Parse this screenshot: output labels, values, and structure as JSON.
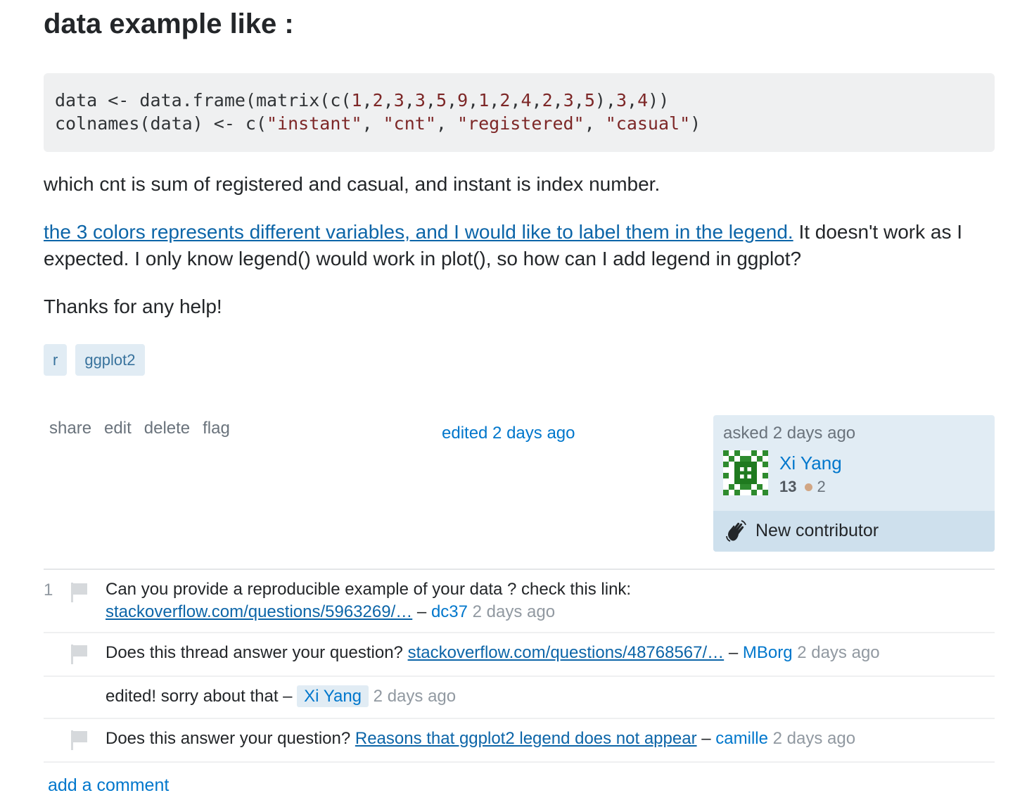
{
  "question": {
    "heading": "data example like :",
    "code_line1": "data <- data.frame(matrix(c(1,2,3,3,5,9,1,2,4,2,3,5),3,4))",
    "code_line2": "colnames(data) <- c(\"instant\", \"cnt\", \"registered\", \"casual\")",
    "para1": "which cnt is sum of registered and casual, and instant is index number.",
    "para2_link": "the 3 colors represents different variables, and I would like to label them in the legend.",
    "para2_text": " It doesn't work as I expected. I only know legend() would work in plot(), so how can I add legend in ggplot?",
    "para3": "Thanks for any help!",
    "tags": [
      "r",
      "ggplot2"
    ]
  },
  "post_menu": {
    "share": "share",
    "edit": "edit",
    "delete": "delete",
    "flag": "flag"
  },
  "edited": "edited 2 days ago",
  "owner": {
    "asked": "asked 2 days ago",
    "name": "Xi Yang",
    "reputation": "13",
    "bronze": "2",
    "badge_label": "New contributor"
  },
  "comments": [
    {
      "score": "1",
      "text": "Can you provide a reproducible example of your data ? check this link: ",
      "link": "stackoverflow.com/questions/5963269/…",
      "sep": " – ",
      "user": "dc37",
      "date": " 2 days ago"
    },
    {
      "text": "Does this thread answer your question? ",
      "link": "stackoverflow.com/questions/48768567/…",
      "sep": " – ",
      "user": "MBorg",
      "date": " 2 days ago"
    },
    {
      "text": "edited! sorry about that – ",
      "user": "Xi Yang",
      "date": " 2 days ago"
    },
    {
      "text": "Does this answer your question? ",
      "link": "Reasons that ggplot2 legend does not appear",
      "sep": " – ",
      "user": "camille",
      "date": " 2 days ago"
    }
  ],
  "add_comment": "add a comment"
}
